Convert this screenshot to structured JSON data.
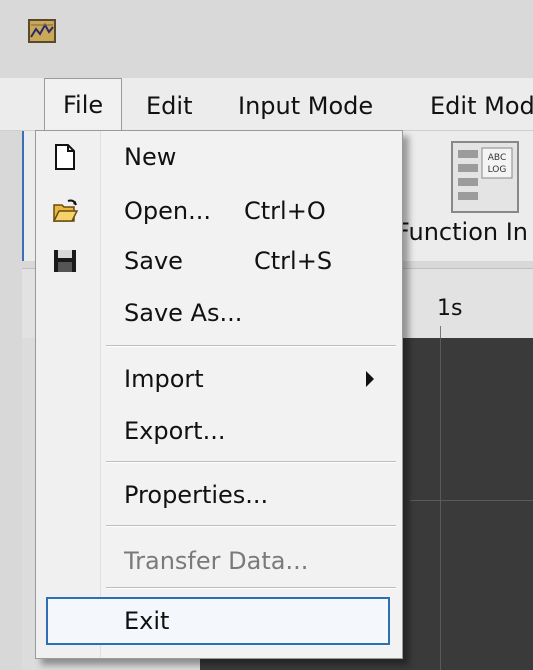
{
  "window": {
    "icon": "app-chart-icon"
  },
  "menubar": {
    "items": [
      {
        "label": "File"
      },
      {
        "label": "Edit"
      },
      {
        "label": "Input Mode"
      },
      {
        "label": "Edit Mod"
      }
    ]
  },
  "toolbar": {
    "function_label": "Function In",
    "function_icon": "function-insert-icon",
    "icon_text_top": "ABC",
    "icon_text_bottom": "LOG"
  },
  "ruler": {
    "label": "1s"
  },
  "file_menu": {
    "items": [
      {
        "label": "New",
        "shortcut": "",
        "icon": "new-file-icon"
      },
      {
        "label": "Open...",
        "shortcut": "Ctrl+O",
        "icon": "open-folder-icon"
      },
      {
        "label": "Save",
        "shortcut": "Ctrl+S",
        "icon": "save-disk-icon"
      },
      {
        "label": "Save As...",
        "shortcut": ""
      },
      {
        "label": "Import",
        "shortcut": "",
        "submenu": true
      },
      {
        "label": "Export...",
        "shortcut": ""
      },
      {
        "label": "Properties...",
        "shortcut": ""
      },
      {
        "label": "Transfer Data...",
        "shortcut": "",
        "disabled": true
      },
      {
        "label": "Exit",
        "shortcut": "",
        "highlighted": true
      }
    ]
  },
  "colors": {
    "highlight_border": "#2f6db5",
    "plot_bg": "#3a3a3a",
    "menu_bg": "#f2f2f2"
  }
}
